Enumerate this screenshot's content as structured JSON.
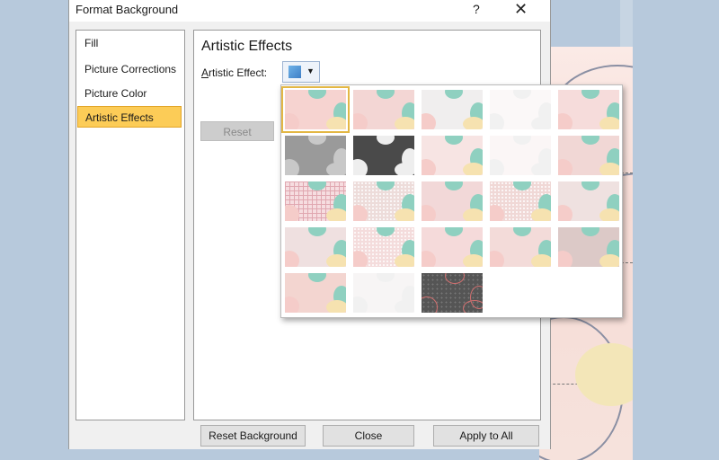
{
  "dialog": {
    "title": "Format Background",
    "help_label": "?",
    "close_label": "✕",
    "nav": [
      {
        "label": "Fill",
        "selected": false
      },
      {
        "label": "Picture Corrections",
        "selected": false
      },
      {
        "label": "Picture Color",
        "selected": false
      },
      {
        "label": "Artistic Effects",
        "selected": true
      }
    ],
    "panel": {
      "title": "Artistic Effects",
      "effect_label_accel": "A",
      "effect_label_rest": "rtistic Effect:",
      "reset_label": "Reset"
    },
    "footer": {
      "reset_background": "Reset Background",
      "close": "Close",
      "apply_to_all": "Apply to All"
    }
  },
  "gallery": {
    "icon": "artistic-effect-preview-icon",
    "selected_index": 0,
    "thumbnail_styles": [
      "none",
      "soft",
      "sketch",
      "faint",
      "blur",
      "grayscale",
      "dark-contrast",
      "pastel",
      "ghost",
      "soft-glow",
      "grid",
      "texture",
      "plastic",
      "chalk",
      "pencil",
      "rough",
      "mosaic",
      "photocopy",
      "film",
      "glow-edges",
      "cement",
      "line-drawing",
      "cutout-dark"
    ]
  },
  "colors": {
    "selected_nav": "#fccc57",
    "pink": "#f6d3d0",
    "teal": "#8fd0c0",
    "yellow": "#f6e2b0"
  }
}
